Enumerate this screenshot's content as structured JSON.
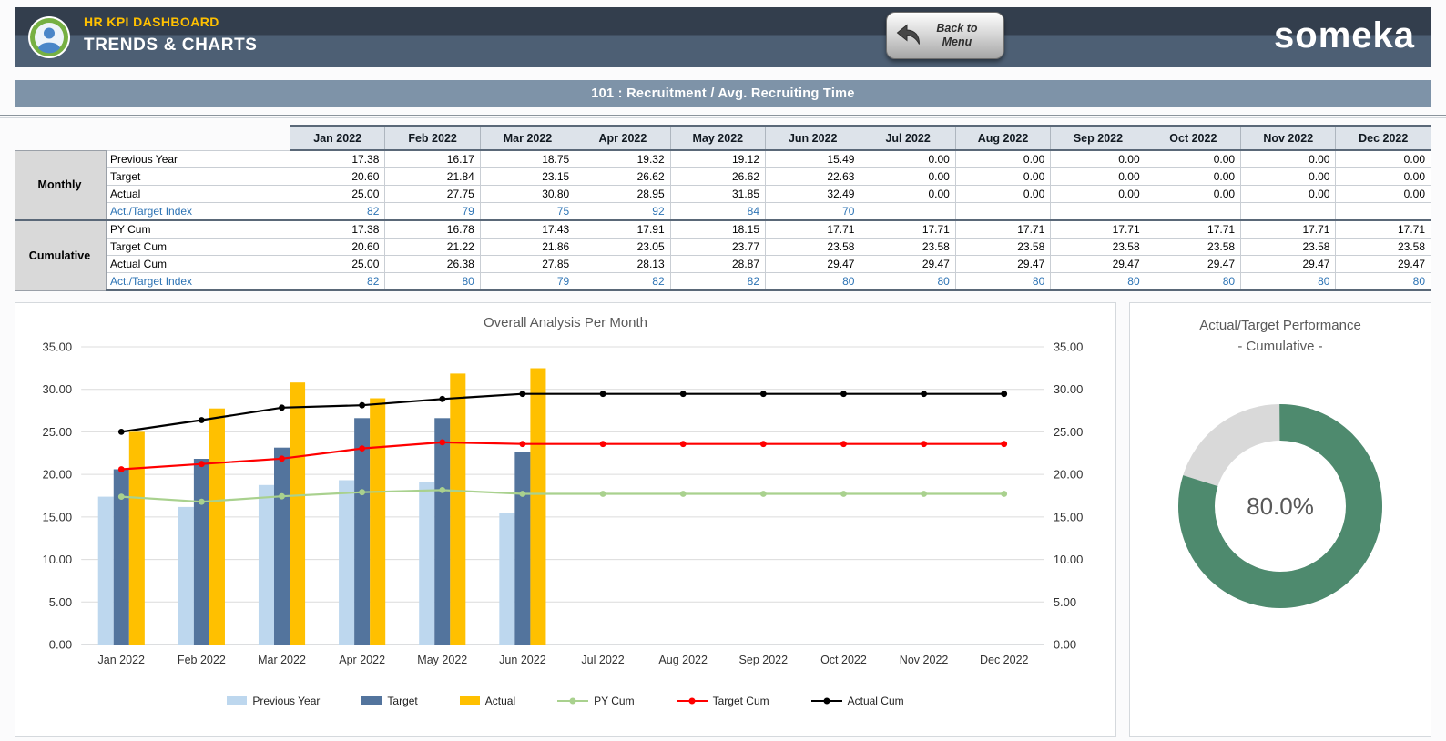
{
  "header": {
    "app_title": "HR KPI DASHBOARD",
    "page_title": "TRENDS & CHARTS",
    "back_button": "Back to Menu",
    "brand": "someka"
  },
  "section_title": "101 : Recruitment / Avg. Recruiting Time",
  "table": {
    "months": [
      "Jan 2022",
      "Feb 2022",
      "Mar 2022",
      "Apr 2022",
      "May 2022",
      "Jun 2022",
      "Jul 2022",
      "Aug 2022",
      "Sep 2022",
      "Oct 2022",
      "Nov 2022",
      "Dec 2022"
    ],
    "groups": [
      {
        "label": "Monthly",
        "rows": [
          {
            "label": "Previous Year",
            "style": "",
            "values": [
              "17.38",
              "16.17",
              "18.75",
              "19.32",
              "19.12",
              "15.49",
              "0.00",
              "0.00",
              "0.00",
              "0.00",
              "0.00",
              "0.00"
            ]
          },
          {
            "label": "Target",
            "style": "",
            "values": [
              "20.60",
              "21.84",
              "23.15",
              "26.62",
              "26.62",
              "22.63",
              "0.00",
              "0.00",
              "0.00",
              "0.00",
              "0.00",
              "0.00"
            ]
          },
          {
            "label": "Actual",
            "style": "",
            "values": [
              "25.00",
              "27.75",
              "30.80",
              "28.95",
              "31.85",
              "32.49",
              "0.00",
              "0.00",
              "0.00",
              "0.00",
              "0.00",
              "0.00"
            ]
          },
          {
            "label": "Act./Target Index",
            "style": "index",
            "values": [
              "82",
              "79",
              "75",
              "92",
              "84",
              "70",
              "",
              "",
              "",
              "",
              "",
              ""
            ]
          }
        ]
      },
      {
        "label": "Cumulative",
        "rows": [
          {
            "label": "PY Cum",
            "style": "",
            "values": [
              "17.38",
              "16.78",
              "17.43",
              "17.91",
              "18.15",
              "17.71",
              "17.71",
              "17.71",
              "17.71",
              "17.71",
              "17.71",
              "17.71"
            ]
          },
          {
            "label": "Target Cum",
            "style": "",
            "values": [
              "20.60",
              "21.22",
              "21.86",
              "23.05",
              "23.77",
              "23.58",
              "23.58",
              "23.58",
              "23.58",
              "23.58",
              "23.58",
              "23.58"
            ]
          },
          {
            "label": "Actual Cum",
            "style": "",
            "values": [
              "25.00",
              "26.38",
              "27.85",
              "28.13",
              "28.87",
              "29.47",
              "29.47",
              "29.47",
              "29.47",
              "29.47",
              "29.47",
              "29.47"
            ]
          },
          {
            "label": "Act./Target Index",
            "style": "index",
            "values": [
              "82",
              "80",
              "79",
              "82",
              "82",
              "80",
              "80",
              "80",
              "80",
              "80",
              "80",
              "80"
            ]
          }
        ]
      }
    ]
  },
  "chart_data": [
    {
      "type": "bar",
      "subtype": "combo-bar-line",
      "title": "Overall Analysis Per Month",
      "categories": [
        "Jan 2022",
        "Feb 2022",
        "Mar 2022",
        "Apr 2022",
        "May 2022",
        "Jun 2022",
        "Jul 2022",
        "Aug 2022",
        "Sep 2022",
        "Oct 2022",
        "Nov 2022",
        "Dec 2022"
      ],
      "ylim": [
        0,
        35
      ],
      "ytick_step": 5,
      "ytick_labels": [
        "0.00",
        "5.00",
        "10.00",
        "15.00",
        "20.00",
        "25.00",
        "30.00",
        "35.00"
      ],
      "grid": true,
      "legend_position": "bottom",
      "bar_series": [
        {
          "name": "Previous Year",
          "color": "#bdd7ee",
          "values": [
            17.38,
            16.17,
            18.75,
            19.32,
            19.12,
            15.49,
            0,
            0,
            0,
            0,
            0,
            0
          ]
        },
        {
          "name": "Target",
          "color": "#53749d",
          "values": [
            20.6,
            21.84,
            23.15,
            26.62,
            26.62,
            22.63,
            0,
            0,
            0,
            0,
            0,
            0
          ]
        },
        {
          "name": "Actual",
          "color": "#ffc000",
          "values": [
            25.0,
            27.75,
            30.8,
            28.95,
            31.85,
            32.49,
            0,
            0,
            0,
            0,
            0,
            0
          ]
        }
      ],
      "line_series": [
        {
          "name": "PY Cum",
          "color": "#a9d18e",
          "values": [
            17.38,
            16.78,
            17.43,
            17.91,
            18.15,
            17.71,
            17.71,
            17.71,
            17.71,
            17.71,
            17.71,
            17.71
          ]
        },
        {
          "name": "Target Cum",
          "color": "#ff0000",
          "values": [
            20.6,
            21.22,
            21.86,
            23.05,
            23.77,
            23.58,
            23.58,
            23.58,
            23.58,
            23.58,
            23.58,
            23.58
          ]
        },
        {
          "name": "Actual Cum",
          "color": "#000000",
          "values": [
            25.0,
            26.38,
            27.85,
            28.13,
            28.87,
            29.47,
            29.47,
            29.47,
            29.47,
            29.47,
            29.47,
            29.47
          ]
        }
      ]
    },
    {
      "type": "pie",
      "subtype": "donut",
      "title": "Actual/Target Performance",
      "subtitle": "- Cumulative -",
      "value_percent": 80.0,
      "label": "80.0%",
      "colors": {
        "value": "#4e8a6e",
        "remainder": "#d9d9d9"
      }
    }
  ]
}
